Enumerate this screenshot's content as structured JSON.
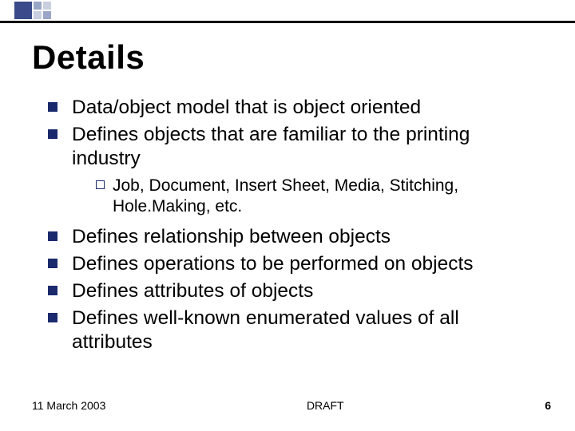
{
  "title": "Details",
  "bullets": [
    {
      "text": "Data/object model that is object oriented"
    },
    {
      "text": "Defines objects that are familiar to the printing industry",
      "sub": [
        {
          "text": "Job, Document, Insert Sheet, Media, Stitching, Hole.Making, etc."
        }
      ]
    },
    {
      "text": "Defines relationship between objects"
    },
    {
      "text": "Defines operations to be performed on objects"
    },
    {
      "text": "Defines attributes of objects"
    },
    {
      "text": "Defines well-known enumerated values of all attributes"
    }
  ],
  "footer": {
    "date": "11 March 2003",
    "center": "DRAFT",
    "page": "6"
  }
}
